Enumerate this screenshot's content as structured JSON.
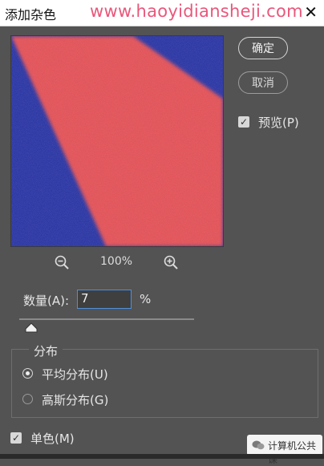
{
  "window": {
    "title": "添加杂色",
    "watermark": "www.haoyidiansheji.com",
    "close_glyph": "✕"
  },
  "buttons": {
    "ok": "确定",
    "cancel": "取消"
  },
  "preview": {
    "label": "预览(P)",
    "checked": true,
    "colors": {
      "background": "#1e2aa4",
      "stripe": "#e84a4f"
    }
  },
  "zoom": {
    "level": "100%",
    "zoom_out_icon": "zoom-out-icon",
    "zoom_in_icon": "zoom-in-icon"
  },
  "amount": {
    "label": "数量(A):",
    "value": "7",
    "unit": "%"
  },
  "distribution": {
    "title": "分布",
    "options": [
      {
        "label": "平均分布(U)",
        "selected": true
      },
      {
        "label": "高斯分布(G)",
        "selected": false
      }
    ]
  },
  "monochrome": {
    "label": "单色(M)",
    "checked": true
  },
  "brand": {
    "text": "计算机公共课"
  }
}
